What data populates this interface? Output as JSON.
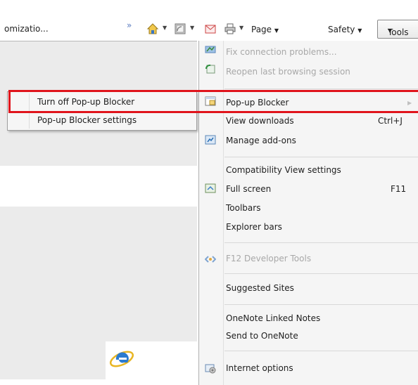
{
  "toolbar": {
    "tab_title": "omizatio...",
    "chevron": "»",
    "page_label": "Page",
    "safety_label": "Safety",
    "tools_label": "Tools",
    "caret": "▼"
  },
  "submenu": {
    "items": [
      {
        "label": "Turn off Pop-up Blocker"
      },
      {
        "label": "Pop-up Blocker settings"
      }
    ]
  },
  "tools_menu": {
    "items": [
      {
        "label": "Fix connection problems...",
        "enabled": false,
        "icon": "network-repair-icon"
      },
      {
        "label": "Reopen last browsing session",
        "enabled": false,
        "icon": "reopen-session-icon"
      },
      {
        "label": "Pop-up Blocker",
        "enabled": true,
        "icon": "popup-blocker-icon",
        "submenu": true
      },
      {
        "label": "View downloads",
        "enabled": true,
        "shortcut": "Ctrl+J"
      },
      {
        "label": "Manage add-ons",
        "enabled": true,
        "icon": "add-ons-icon"
      },
      {
        "label": "Compatibility View settings",
        "enabled": true
      },
      {
        "label": "Full screen",
        "enabled": true,
        "shortcut": "F11",
        "icon": "full-screen-icon"
      },
      {
        "label": "Toolbars",
        "enabled": true,
        "submenu": true
      },
      {
        "label": "Explorer bars",
        "enabled": true,
        "submenu": true
      },
      {
        "label": "F12 Developer Tools",
        "enabled": false,
        "icon": "developer-tools-icon"
      },
      {
        "label": "Suggested Sites",
        "enabled": true
      },
      {
        "label": "OneNote Linked Notes",
        "enabled": true
      },
      {
        "label": "Send to OneNote",
        "enabled": true
      },
      {
        "label": "Internet options",
        "enabled": true,
        "icon": "internet-options-icon"
      }
    ],
    "submenu_arrow": "▶"
  },
  "colors": {
    "highlight_border": "#e0141c",
    "menu_background": "#f5f5f5",
    "page_gray": "#ebebeb",
    "disabled_text": "#a8a8a8"
  },
  "icons": [
    "home-icon",
    "feeds-icon",
    "read-mail-icon",
    "print-icon",
    "internet-explorer-logo"
  ]
}
